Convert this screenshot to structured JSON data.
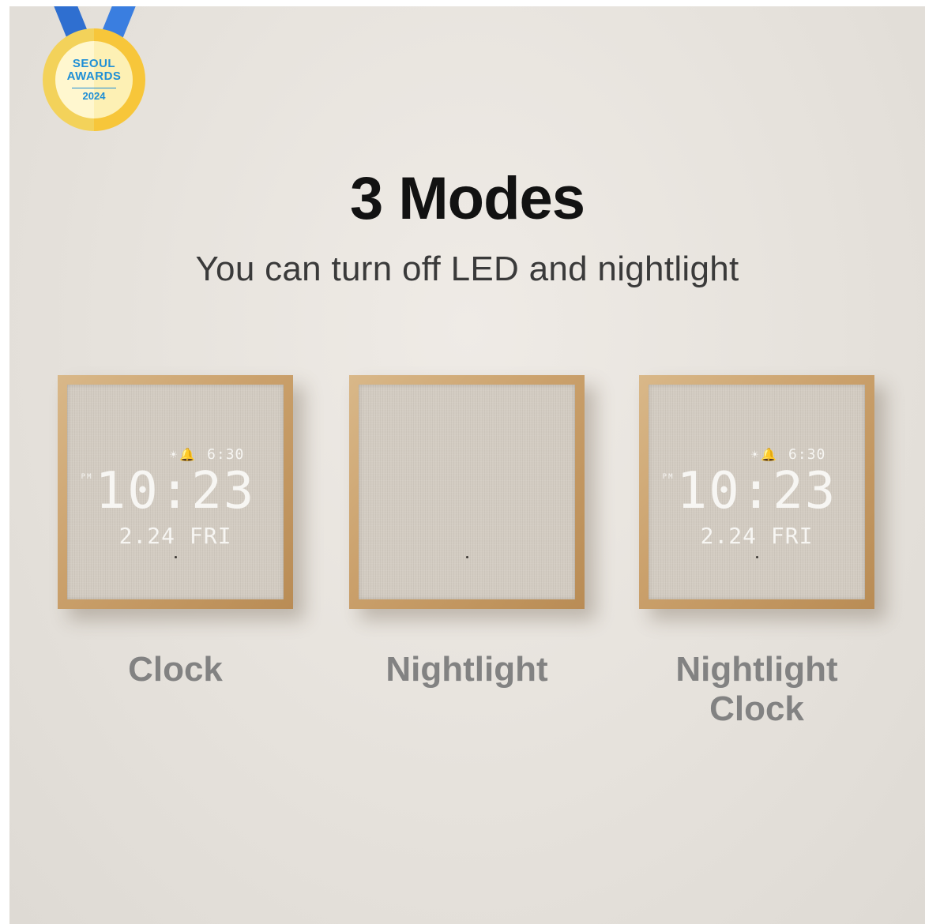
{
  "badge": {
    "line1": "SEOUL",
    "line2": "AWARDS",
    "year": "2024"
  },
  "heading": {
    "title": "3 Modes",
    "subtitle": "You can turn off LED and nightlight"
  },
  "clock_display": {
    "alarm": "6:30",
    "am_pm": "PM",
    "time": "10:23",
    "date": "2.24 FRI"
  },
  "modes": [
    {
      "label": "Clock"
    },
    {
      "label": "Nightlight"
    },
    {
      "label_line1": "Nightlight",
      "label_line2": "Clock"
    }
  ],
  "colors": {
    "background": "#e6e2dc",
    "wood": "#caa06b",
    "fabric": "#d3ccc2",
    "badge_ribbon": "#2f6fd0",
    "badge_gold": "#f3d25a"
  },
  "icons": [
    "sun-icon",
    "alarm-bell-icon"
  ]
}
